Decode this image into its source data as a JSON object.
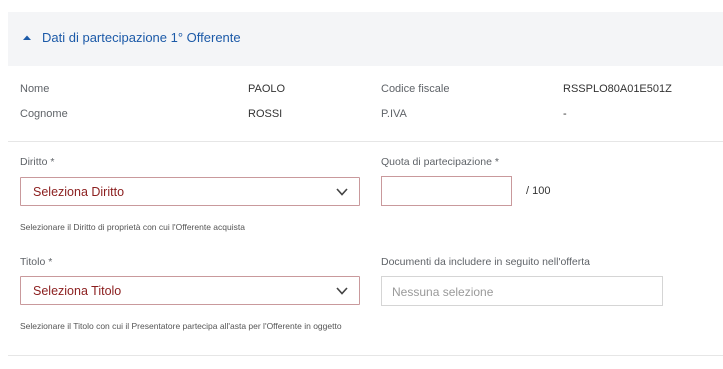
{
  "section": {
    "title": "Dati di partecipazione 1° Offerente"
  },
  "person": {
    "nome_label": "Nome",
    "nome_value": "PAOLO",
    "cognome_label": "Cognome",
    "cognome_value": "ROSSI",
    "cf_label": "Codice fiscale",
    "cf_value": "RSSPLO80A01E501Z",
    "piva_label": "P.IVA",
    "piva_value": "-"
  },
  "diritto": {
    "label": "Diritto *",
    "selected": "Seleziona Diritto",
    "hint": "Selezionare il Diritto di proprietà con cui l'Offerente acquista"
  },
  "quota": {
    "label": "Quota di partecipazione *",
    "value": "",
    "suffix": "/ 100"
  },
  "titolo": {
    "label": "Titolo *",
    "selected": "Seleziona Titolo",
    "hint": "Selezionare il Titolo con cui il Presentatore partecipa all'asta per l'Offerente in oggetto"
  },
  "documenti": {
    "label": "Documenti da includere in seguito nell'offerta",
    "placeholder": "Nessuna selezione"
  },
  "icons": {
    "toggle": "chevron-up-icon",
    "select_caret": "chevron-down-icon"
  },
  "colors": {
    "accent_blue": "#1c5aa8",
    "error_border": "#c9999c",
    "error_text": "#8b1e1e"
  }
}
